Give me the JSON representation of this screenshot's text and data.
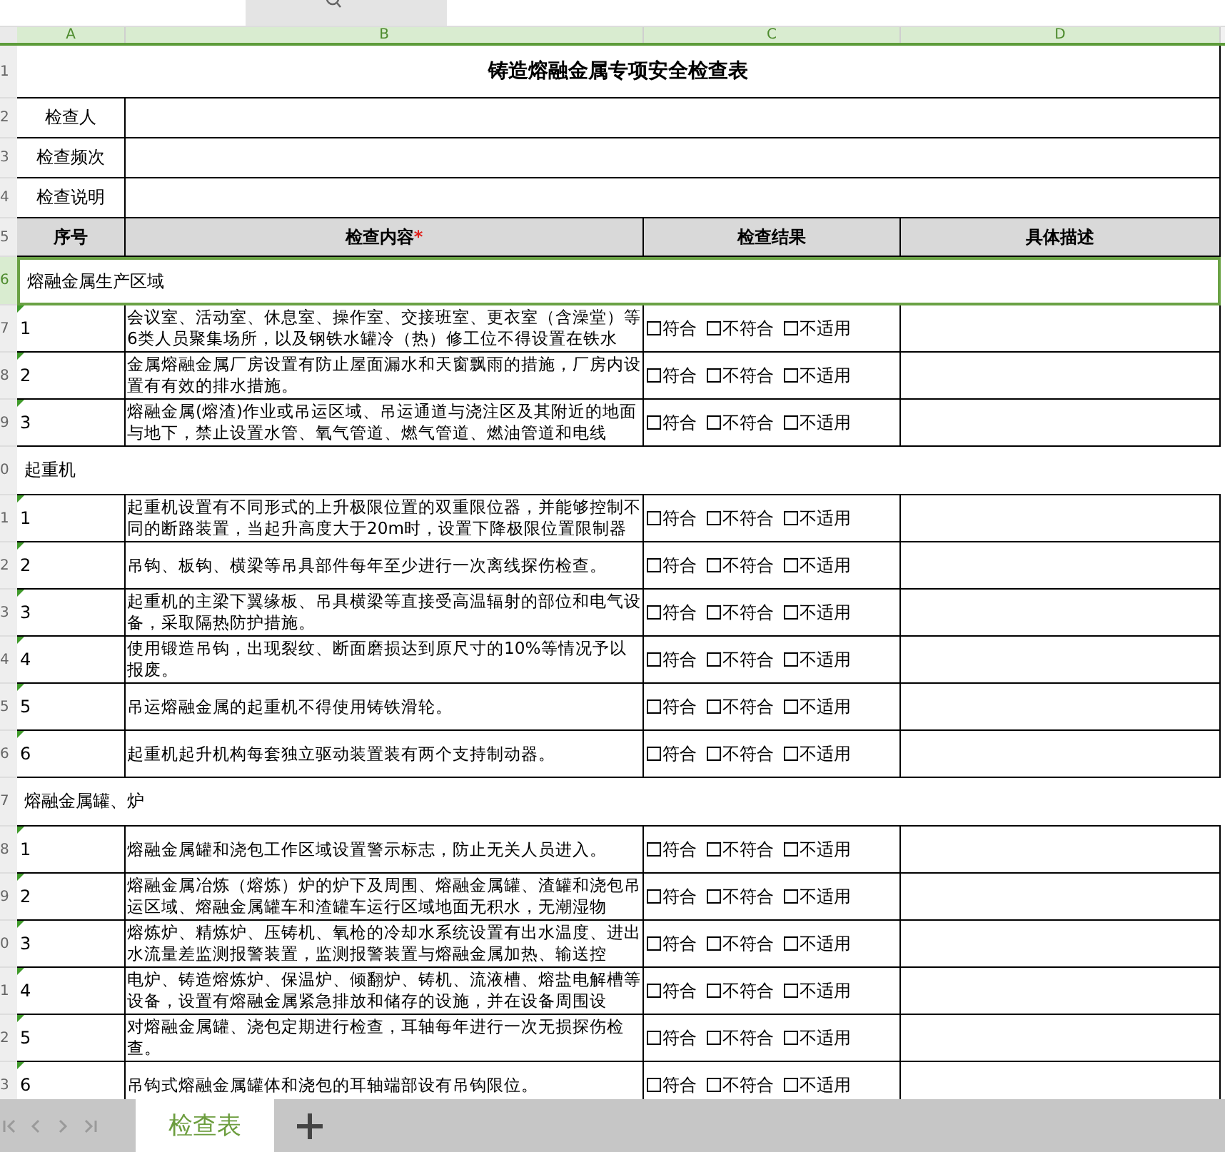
{
  "column_headers": [
    {
      "label": "A",
      "selected": true
    },
    {
      "label": "B",
      "selected": true
    },
    {
      "label": "C",
      "selected": true
    },
    {
      "label": "D",
      "selected": true
    }
  ],
  "row_numbers": [
    "1",
    "2",
    "3",
    "4",
    "5",
    "6",
    "7",
    "8",
    "9",
    "0",
    "1",
    "2",
    "3",
    "4",
    "5",
    "6",
    "7",
    "8",
    "9",
    "0",
    "1",
    "2",
    "3"
  ],
  "title": "铸造熔融金属专项安全检查表",
  "info_rows": [
    {
      "label": "检查人"
    },
    {
      "label": "检查频次"
    },
    {
      "label": "检查说明"
    }
  ],
  "table_header": [
    {
      "label": "序号"
    },
    {
      "label": "检查内容",
      "required_mark": "*"
    },
    {
      "label": "检查结果"
    },
    {
      "label": "具体描述"
    }
  ],
  "sections": [
    {
      "title": "熔融金属生产区域",
      "selected": true,
      "items": [
        {
          "number": "1",
          "marker": true,
          "text": "会议室、活动室、休息室、操作室、交接班室、更衣室（含澡堂）等6类人员聚集场所，以及钢铁水罐冷（热）修工位不得设置在铁水",
          "results": [
            {
              "label": "符合",
              "checked": false
            },
            {
              "label": "不符合",
              "checked": false
            },
            {
              "label": "不适用",
              "checked": false
            }
          ]
        },
        {
          "number": "2",
          "marker": true,
          "text": "金属熔融金属厂房设置有防止屋面漏水和天窗飘雨的措施，厂房内设置有有效的排水措施。",
          "results": [
            {
              "label": "符合",
              "checked": false
            },
            {
              "label": "不符合",
              "checked": false
            },
            {
              "label": "不适用",
              "checked": false
            }
          ]
        },
        {
          "number": "3",
          "marker": true,
          "text": "熔融金属(熔渣)作业或吊运区域、吊运通道与浇注区及其附近的地面与地下，禁止设置水管、氧气管道、燃气管道、燃油管道和电线",
          "results": [
            {
              "label": "符合",
              "checked": false
            },
            {
              "label": "不符合",
              "checked": false
            },
            {
              "label": "不适用",
              "checked": false
            }
          ]
        }
      ]
    },
    {
      "title": "起重机",
      "selected": false,
      "items": [
        {
          "number": "1",
          "marker": true,
          "text": "起重机设置有不同形式的上升极限位置的双重限位器，并能够控制不同的断路装置，当起升高度大于20m时，设置下降极限位置限制器",
          "results": [
            {
              "label": "符合",
              "checked": false
            },
            {
              "label": "不符合",
              "checked": false
            },
            {
              "label": "不适用",
              "checked": false
            }
          ]
        },
        {
          "number": "2",
          "marker": true,
          "text": "吊钩、板钩、横梁等吊具部件每年至少进行一次离线探伤检查。",
          "results": [
            {
              "label": "符合",
              "checked": false
            },
            {
              "label": "不符合",
              "checked": false
            },
            {
              "label": "不适用",
              "checked": false
            }
          ]
        },
        {
          "number": "3",
          "marker": true,
          "text": "起重机的主梁下翼缘板、吊具横梁等直接受高温辐射的部位和电气设备，采取隔热防护措施。",
          "results": [
            {
              "label": "符合",
              "checked": false
            },
            {
              "label": "不符合",
              "checked": false
            },
            {
              "label": "不适用",
              "checked": false
            }
          ]
        },
        {
          "number": "4",
          "marker": true,
          "text": "使用锻造吊钩，出现裂纹、断面磨损达到原尺寸的10%等情况予以报废。",
          "results": [
            {
              "label": "符合",
              "checked": false
            },
            {
              "label": "不符合",
              "checked": false
            },
            {
              "label": "不适用",
              "checked": false
            }
          ]
        },
        {
          "number": "5",
          "marker": true,
          "text": "吊运熔融金属的起重机不得使用铸铁滑轮。",
          "results": [
            {
              "label": "符合",
              "checked": false
            },
            {
              "label": "不符合",
              "checked": false
            },
            {
              "label": "不适用",
              "checked": false
            }
          ]
        },
        {
          "number": "6",
          "marker": true,
          "text": "起重机起升机构每套独立驱动装置装有两个支持制动器。",
          "results": [
            {
              "label": "符合",
              "checked": false
            },
            {
              "label": "不符合",
              "checked": false
            },
            {
              "label": "不适用",
              "checked": false
            }
          ]
        }
      ]
    },
    {
      "title": "熔融金属罐、炉",
      "selected": false,
      "items": [
        {
          "number": "1",
          "marker": true,
          "text": "熔融金属罐和浇包工作区域设置警示标志，防止无关人员进入。",
          "results": [
            {
              "label": "符合",
              "checked": false
            },
            {
              "label": "不符合",
              "checked": false
            },
            {
              "label": "不适用",
              "checked": false
            }
          ]
        },
        {
          "number": "2",
          "marker": true,
          "text": "熔融金属冶炼（熔炼）炉的炉下及周围、熔融金属罐、渣罐和浇包吊运区域、熔融金属罐车和渣罐车运行区域地面无积水，无潮湿物",
          "results": [
            {
              "label": "符合",
              "checked": false
            },
            {
              "label": "不符合",
              "checked": false
            },
            {
              "label": "不适用",
              "checked": false
            }
          ]
        },
        {
          "number": "3",
          "marker": true,
          "text": "熔炼炉、精炼炉、压铸机、氧枪的冷却水系统设置有出水温度、进出水流量差监测报警装置，监测报警装置与熔融金属加热、输送控",
          "results": [
            {
              "label": "符合",
              "checked": false
            },
            {
              "label": "不符合",
              "checked": false
            },
            {
              "label": "不适用",
              "checked": false
            }
          ]
        },
        {
          "number": "4",
          "marker": true,
          "text": "电炉、铸造熔炼炉、保温炉、倾翻炉、铸机、流液槽、熔盐电解槽等设备，设置有熔融金属紧急排放和储存的设施，并在设备周围设",
          "results": [
            {
              "label": "符合",
              "checked": false
            },
            {
              "label": "不符合",
              "checked": false
            },
            {
              "label": "不适用",
              "checked": false
            }
          ]
        },
        {
          "number": "5",
          "marker": true,
          "text": "对熔融金属罐、浇包定期进行检查，耳轴每年进行一次无损探伤检查。",
          "results": [
            {
              "label": "符合",
              "checked": false
            },
            {
              "label": "不符合",
              "checked": false
            },
            {
              "label": "不适用",
              "checked": false
            }
          ]
        },
        {
          "number": "6",
          "marker": true,
          "text": "吊钩式熔融金属罐体和浇包的耳轴端部设有吊钩限位。",
          "results": [
            {
              "label": "符合",
              "checked": false
            },
            {
              "label": "不符合",
              "checked": false
            },
            {
              "label": "不适用",
              "checked": false
            }
          ]
        }
      ]
    }
  ],
  "sheet_tabs": [
    {
      "label": "检查表",
      "selected": true
    }
  ]
}
